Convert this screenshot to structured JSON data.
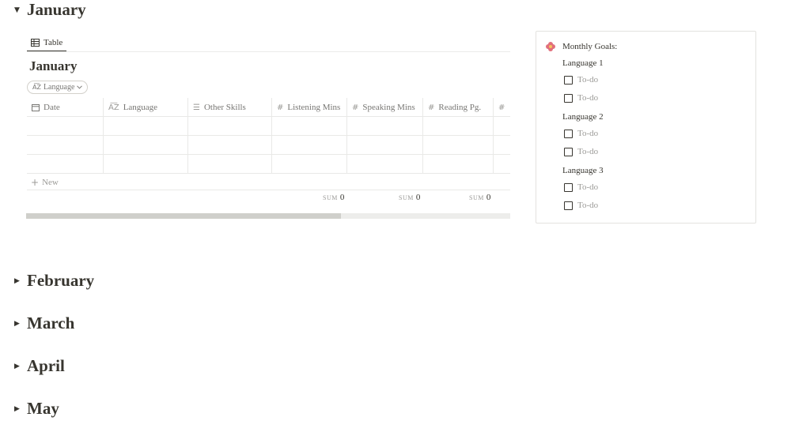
{
  "sections": [
    {
      "title": "January",
      "expanded": true
    },
    {
      "title": "February",
      "expanded": false
    },
    {
      "title": "March",
      "expanded": false
    },
    {
      "title": "April",
      "expanded": false
    },
    {
      "title": "May",
      "expanded": false
    }
  ],
  "arrows": {
    "expanded": "▼",
    "collapsed": "▶"
  },
  "view": {
    "tab_label": "Table",
    "tab_icon": "table-icon"
  },
  "database": {
    "title": "January",
    "filter_label": "Language",
    "columns": [
      {
        "label": "Date",
        "icon": "calendar-icon"
      },
      {
        "label": "Language",
        "icon": "text-property-icon"
      },
      {
        "label": "Other Skills",
        "icon": "list-icon"
      },
      {
        "label": "Listening Mins",
        "icon": "number-icon"
      },
      {
        "label": "Speaking Mins",
        "icon": "number-icon"
      },
      {
        "label": "Reading Pg.",
        "icon": "number-icon"
      },
      {
        "label": "",
        "icon": "number-icon"
      }
    ],
    "new_label": "New",
    "sums": [
      {
        "label": "SUM",
        "value": "0"
      },
      {
        "label": "SUM",
        "value": "0"
      },
      {
        "label": "SUM",
        "value": "0"
      }
    ],
    "scroll_fraction": 0.65
  },
  "goals": {
    "icon": "flower-icon",
    "title": "Monthly Goals:",
    "languages": [
      {
        "name": "Language 1",
        "todos": [
          "To-do",
          "To-do"
        ]
      },
      {
        "name": "Language 2",
        "todos": [
          "To-do",
          "To-do"
        ]
      },
      {
        "name": "Language 3",
        "todos": [
          "To-do",
          "To-do"
        ]
      }
    ]
  },
  "colors": {
    "text": "#37352f",
    "muted": "#9b9a97",
    "border": "#e9e9e7",
    "flower": "#e16f7c"
  }
}
